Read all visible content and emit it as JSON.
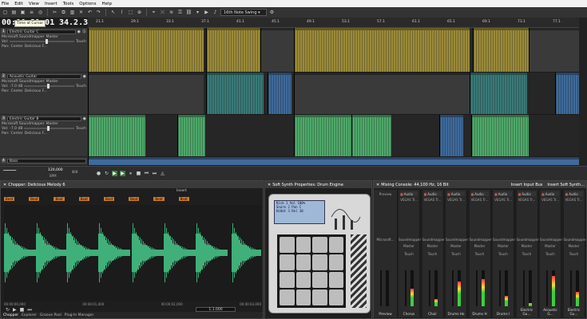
{
  "menu": [
    "File",
    "Edit",
    "View",
    "Insert",
    "Tools",
    "Options",
    "Help"
  ],
  "toolbar": {
    "grid_combo": "16th Note Swing"
  },
  "timecode": "00:00:21.01",
  "tempo": "34.2.377",
  "tooltip": "Time at Cursor",
  "ruler_marks": [
    "21.1",
    "29.1",
    "33.1",
    "37.1",
    "41.1",
    "45.1",
    "49.1",
    "53.1",
    "57.1",
    "61.1",
    "65.1",
    "69.1",
    "73.1",
    "77.1"
  ],
  "tracks": [
    {
      "num": "1",
      "name": "Electric Guitar C",
      "device": "Microsoft Soundmapper",
      "bus": "Master",
      "vol": "Vol:",
      "pan": "Pan:",
      "pan_val": "Center",
      "mode": "Touch",
      "fx": "Delicious F..."
    },
    {
      "num": "2",
      "name": "Acoustic Guitar",
      "device": "Microsoft Soundmapper",
      "bus": "Master",
      "vol": "Vol:",
      "vol_val": "-7.0 dB",
      "pan": "Pan:",
      "pan_val": "Center",
      "mode": "Touch",
      "fx": "Delicious F..."
    },
    {
      "num": "3",
      "name": "Electric Guitar B",
      "device": "Microsoft Soundmapper",
      "bus": "Master",
      "vol": "Vol:",
      "vol_val": "-7.0 dB",
      "pan": "Pan:",
      "pan_val": "Center",
      "mode": "Touch",
      "fx": "Delicious F..."
    },
    {
      "num": "4",
      "name": "Bass"
    }
  ],
  "transport": {
    "bpm": "120,000",
    "bpm_label": "BPM",
    "meter": "4/4"
  },
  "chopper": {
    "title": "Chopper: Delicious Melody 6",
    "insert": "Insert",
    "beat_label": "Beat",
    "position": "1.1.000",
    "time_marks": [
      "00:00:00,000",
      "00:00:01,000",
      "00:00:02,000",
      "00:00:03,000"
    ]
  },
  "synth": {
    "title": "Soft Synth Properties: Drum Engine",
    "lcd": [
      "Kick 1 Vol 100%",
      "Snare 2 Pan C",
      "HiHat 3 Rel 30"
    ]
  },
  "mixer": {
    "title": "Mixing Console: 44,100 Hz, 16 Bit",
    "insert_bus": "Insert Input Bus",
    "insert_synth": "Insert Soft Synth...",
    "preview": "Preview",
    "device": "Microsoft...",
    "strips": [
      {
        "insert": "Audio",
        "fx": "VEGAS Tr...",
        "out": "Soundmapper",
        "bus": "Master",
        "mode": "Touch",
        "name": "Chorus"
      },
      {
        "insert": "Audio",
        "fx": "VEGAS Tr...",
        "out": "Soundmapper",
        "bus": "Master",
        "mode": "Touch",
        "name": "Choir"
      },
      {
        "insert": "Audio",
        "fx": "VEGAS Tr...",
        "out": "Soundmapper",
        "bus": "Master",
        "mode": "Touch",
        "name": "Drums Ho"
      },
      {
        "insert": "Audio",
        "fx": "VEGAS Tr...",
        "out": "Soundmapper",
        "bus": "Master",
        "mode": "Touch",
        "name": "Drums H"
      },
      {
        "insert": "Audio",
        "fx": "VEGAS Tr...",
        "out": "Soundmapper",
        "bus": "Master",
        "mode": "Touch",
        "name": "Drums I"
      },
      {
        "insert": "Audio",
        "fx": "VEGAS Tr...",
        "out": "Soundmapper",
        "bus": "Master",
        "mode": "Touch",
        "name": "Electric Gu..."
      },
      {
        "insert": "Audio",
        "fx": "VEGAS Tr...",
        "out": "Soundmapper",
        "bus": "Master",
        "mode": "Touch",
        "name": "Acoustic G..."
      },
      {
        "insert": "Audio",
        "fx": "VEGAS Tr...",
        "out": "Soundmapper",
        "bus": "Master",
        "mode": "Touch",
        "name": "Electric Gu..."
      }
    ]
  },
  "bottom_tabs": [
    "Chopper",
    "Explorer",
    "Groove Pool",
    "Plug-In Manager"
  ]
}
